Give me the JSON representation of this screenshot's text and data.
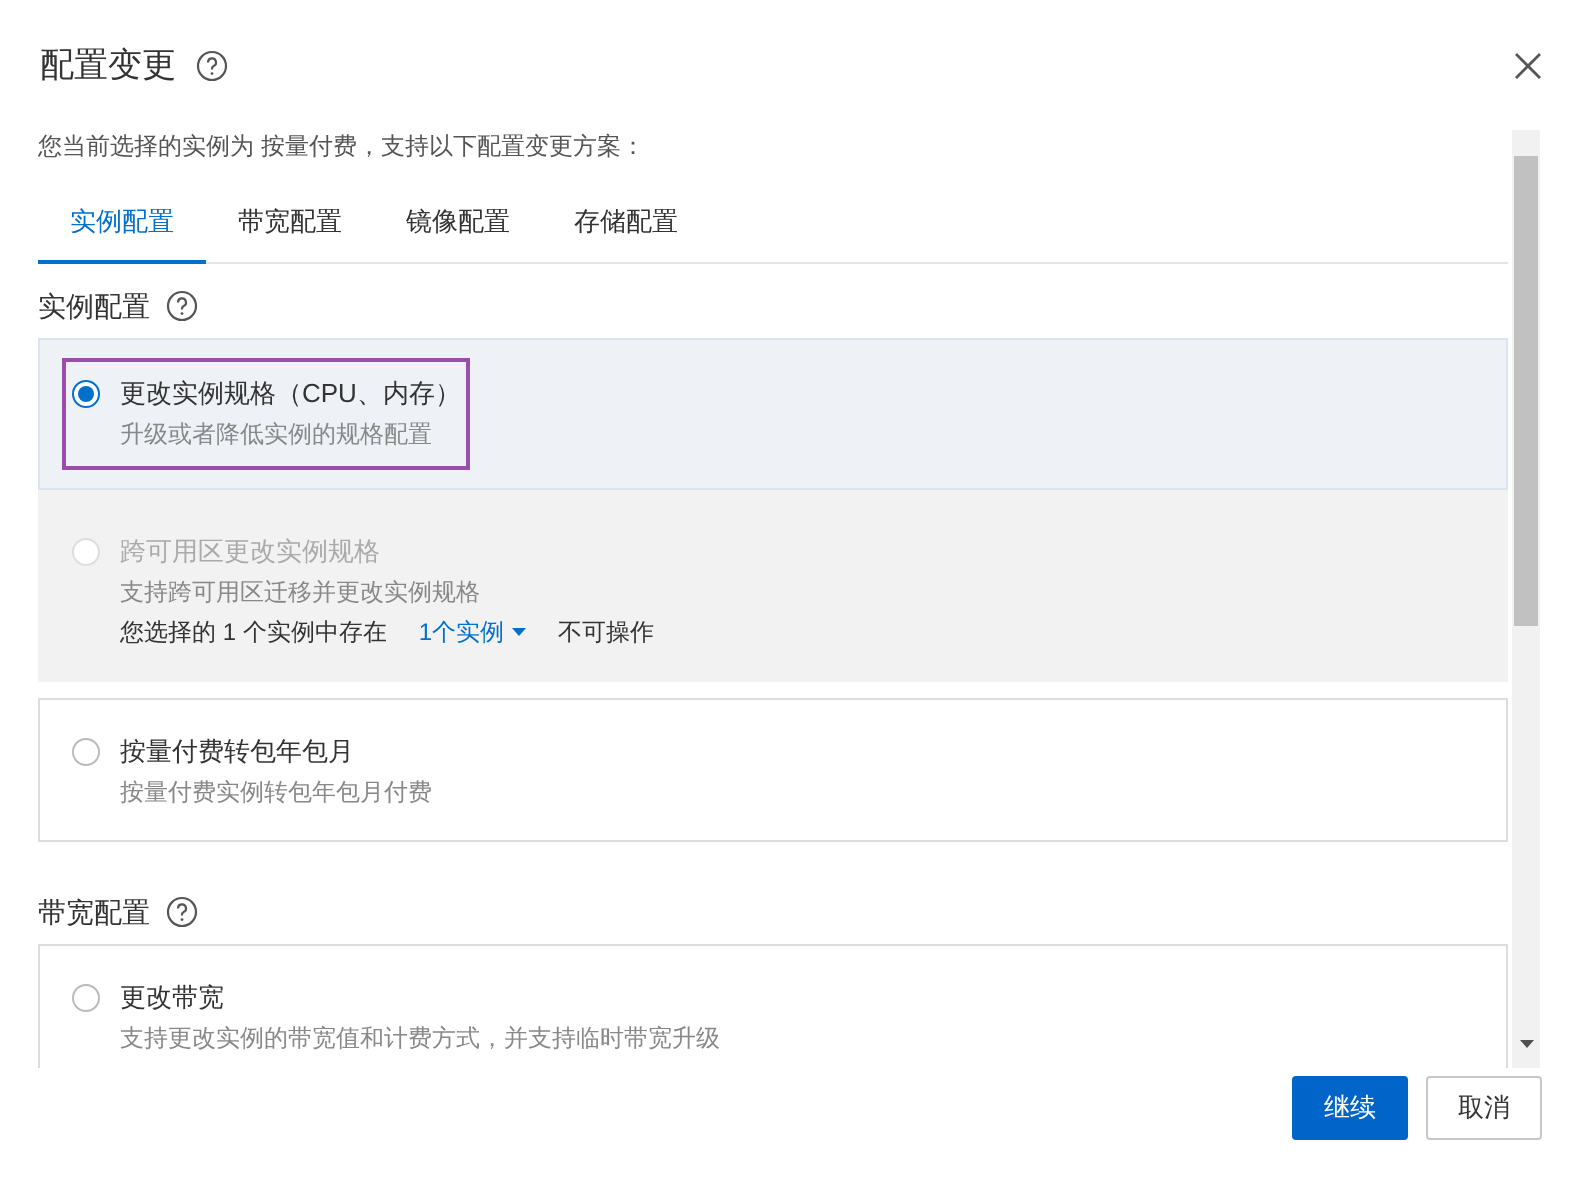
{
  "title": "配置变更",
  "intro": "您当前选择的实例为 按量付费，支持以下配置变更方案：",
  "tabs": [
    {
      "label": "实例配置",
      "selected": true
    },
    {
      "label": "带宽配置",
      "selected": false
    },
    {
      "label": "镜像配置",
      "selected": false
    },
    {
      "label": "存储配置",
      "selected": false
    }
  ],
  "sections": [
    {
      "title": "实例配置",
      "options": [
        {
          "label": "更改实例规格（CPU、内存）",
          "description": "升级或者降低实例的规格配置",
          "selected": true,
          "disabled": false,
          "highlighted": true
        },
        {
          "label": "跨可用区更改实例规格",
          "description": "支持跨可用区迁移并更改实例规格",
          "selected": false,
          "disabled": true,
          "highlighted": false,
          "note": {
            "prefix": "您选择的 1 个实例中存在",
            "link": "1个实例",
            "suffix": "不可操作"
          }
        },
        {
          "label": "按量付费转包年包月",
          "description": "按量付费实例转包年包月付费",
          "selected": false,
          "disabled": false,
          "highlighted": false
        }
      ]
    },
    {
      "title": "带宽配置",
      "options": [
        {
          "label": "更改带宽",
          "description": "支持更改实例的带宽值和计费方式，并支持临时带宽升级",
          "selected": false,
          "disabled": false,
          "highlighted": false
        }
      ]
    }
  ],
  "buttons": [
    {
      "label": "继续",
      "kind": "primary"
    },
    {
      "label": "取消",
      "kind": "default"
    }
  ]
}
